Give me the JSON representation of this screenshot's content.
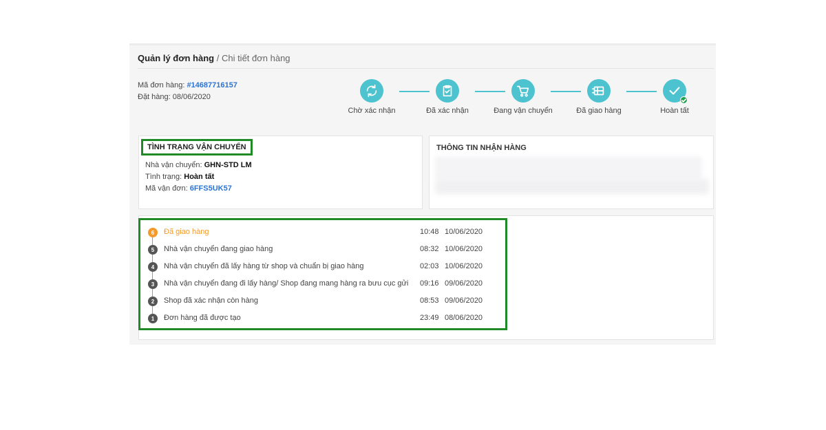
{
  "breadcrumb": {
    "current": "Quản lý đơn hàng",
    "separator": "/",
    "sub": "Chi tiết đơn hàng"
  },
  "order": {
    "id_label": "Mã đơn hàng:",
    "id_value": "#14687716157",
    "date_label": "Đặt hàng:",
    "date_value": "08/06/2020"
  },
  "steps": [
    {
      "label": "Chờ xác nhận",
      "icon": "refresh-icon"
    },
    {
      "label": "Đã xác nhận",
      "icon": "clipboard-check-icon"
    },
    {
      "label": "Đang vận chuyển",
      "icon": "cart-icon"
    },
    {
      "label": "Đã giao hàng",
      "icon": "delivery-box-icon"
    },
    {
      "label": "Hoàn tất",
      "icon": "check-icon"
    }
  ],
  "shipping": {
    "title": "TÌNH TRẠNG VẬN CHUYỂN",
    "carrier_label": "Nhà vận chuyển:",
    "carrier_value": "GHN-STD LM",
    "status_label": "Tình trạng:",
    "status_value": "Hoàn tất",
    "tracking_label": "Mã vận đơn:",
    "tracking_value": "6FFS5UK57"
  },
  "receive": {
    "title": "THÔNG TIN NHẬN HÀNG"
  },
  "timeline": [
    {
      "num": "6",
      "text": "Đã giao hàng",
      "time": "10:48",
      "date": "10/06/2020",
      "active": true
    },
    {
      "num": "5",
      "text": "Nhà vận chuyển đang giao hàng",
      "time": "08:32",
      "date": "10/06/2020"
    },
    {
      "num": "4",
      "text": "Nhà vận chuyển đã lấy hàng từ shop và chuẩn bị giao hàng",
      "time": "02:03",
      "date": "10/06/2020"
    },
    {
      "num": "3",
      "text": "Nhà vận chuyển đang đi lấy hàng/ Shop đang mang hàng ra bưu cục gửi",
      "time": "09:16",
      "date": "09/06/2020"
    },
    {
      "num": "2",
      "text": "Shop đã xác nhận còn hàng",
      "time": "08:53",
      "date": "09/06/2020"
    },
    {
      "num": "1",
      "text": "Đơn hàng đã được tạo",
      "time": "23:49",
      "date": "08/06/2020"
    }
  ],
  "colors": {
    "accent": "#4dc3cf",
    "active": "#f39a2b",
    "highlight_border": "#1f8a26",
    "link": "#2a74d8"
  }
}
